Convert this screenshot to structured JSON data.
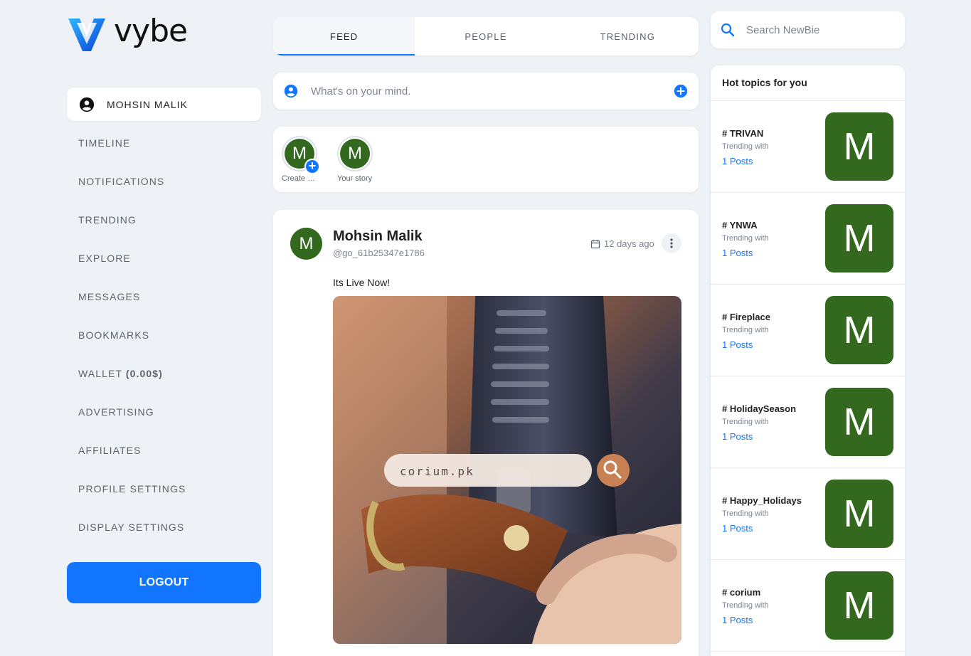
{
  "brand": {
    "name": "vybe",
    "accent": "#1275ff",
    "avatar_color": "#33691e"
  },
  "sidebar": {
    "profile": {
      "label": "MOHSIN MALIK",
      "icon": "account-circle-icon"
    },
    "items": [
      {
        "label": "TIMELINE"
      },
      {
        "label": "NOTIFICATIONS"
      },
      {
        "label": "TRENDING"
      },
      {
        "label": "EXPLORE"
      },
      {
        "label": "MESSAGES"
      },
      {
        "label": "BOOKMARKS"
      },
      {
        "label": "WALLET",
        "extra": "(0.00$)"
      },
      {
        "label": "ADVERTISING"
      },
      {
        "label": "AFFILIATES"
      },
      {
        "label": "PROFILE SETTINGS"
      },
      {
        "label": "DISPLAY SETTINGS"
      }
    ],
    "logout_label": "LOGOUT"
  },
  "tabs": [
    {
      "label": "FEED",
      "active": true
    },
    {
      "label": "PEOPLE",
      "active": false
    },
    {
      "label": "TRENDING",
      "active": false
    }
  ],
  "composer": {
    "placeholder": "What's on your mind.",
    "user_icon": "account-circle-icon",
    "add_icon": "plus-circle-icon"
  },
  "stories": [
    {
      "initial": "M",
      "caption": "Create Story",
      "has_plus": true
    },
    {
      "initial": "M",
      "caption": "Your story",
      "has_plus": false
    }
  ],
  "post": {
    "initial": "M",
    "author": "Mohsin Malik",
    "handle": "@go_61b25347e1786",
    "time": "12 days ago",
    "text": "Its Live Now!",
    "image": {
      "search_text": "corium.pk"
    }
  },
  "search": {
    "placeholder": "Search  NewBie"
  },
  "topics": {
    "heading": "Hot topics for you",
    "items": [
      {
        "name": "# TRIVAN",
        "sub": "Trending with",
        "count": "1 Posts",
        "initial": "M"
      },
      {
        "name": "# YNWA",
        "sub": "Trending with",
        "count": "1 Posts",
        "initial": "M"
      },
      {
        "name": "# Fireplace",
        "sub": "Trending with",
        "count": "1 Posts",
        "initial": "M"
      },
      {
        "name": "# HolidaySeason",
        "sub": "Trending with",
        "count": "1 Posts",
        "initial": "M"
      },
      {
        "name": "# Happy_Holidays",
        "sub": "Trending with",
        "count": "1 Posts",
        "initial": "M"
      },
      {
        "name": "# corium",
        "sub": "Trending with",
        "count": "1 Posts",
        "initial": "M"
      }
    ]
  }
}
